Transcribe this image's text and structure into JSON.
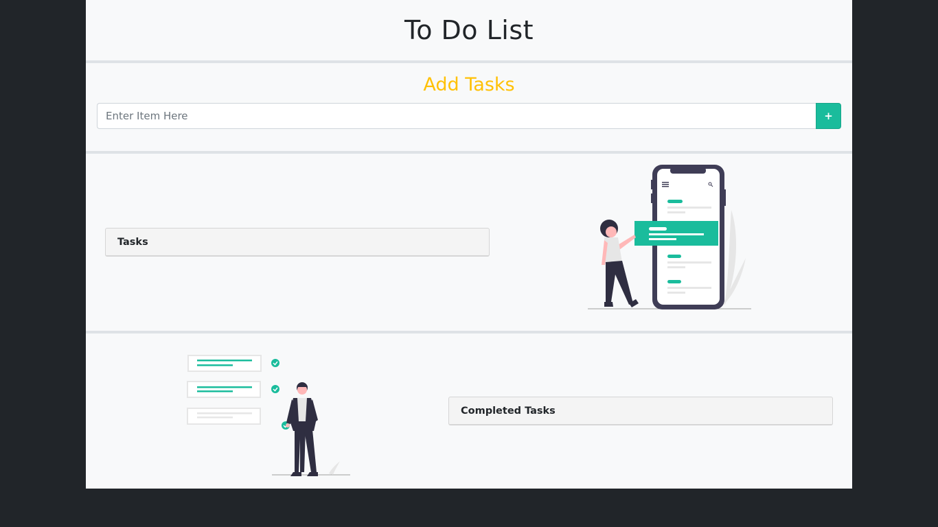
{
  "header": {
    "title": "To Do List"
  },
  "add_section": {
    "heading": "Add Tasks",
    "input_placeholder": "Enter Item Here",
    "input_value": "",
    "add_button_label": "+"
  },
  "tasks_section": {
    "card_title": "Tasks",
    "illustration": "person-with-phone-illustration"
  },
  "completed_section": {
    "card_title": "Completed Tasks",
    "illustration": "person-with-checklist-illustration"
  },
  "colors": {
    "background": "#212529",
    "page": "#f8f9fa",
    "accent_yellow": "#ffc107",
    "accent_teal": "#1abc9c",
    "divider": "#dee2e6"
  }
}
